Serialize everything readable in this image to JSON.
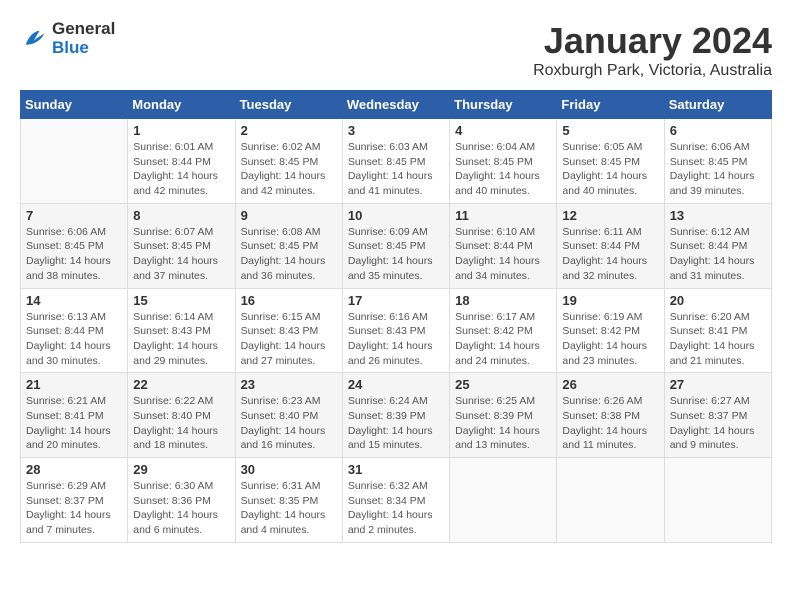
{
  "logo": {
    "line1": "General",
    "line2": "Blue"
  },
  "title": "January 2024",
  "subtitle": "Roxburgh Park, Victoria, Australia",
  "weekdays": [
    "Sunday",
    "Monday",
    "Tuesday",
    "Wednesday",
    "Thursday",
    "Friday",
    "Saturday"
  ],
  "weeks": [
    [
      {
        "day": "",
        "sunrise": "",
        "sunset": "",
        "daylight": ""
      },
      {
        "day": "1",
        "sunrise": "Sunrise: 6:01 AM",
        "sunset": "Sunset: 8:44 PM",
        "daylight": "Daylight: 14 hours and 42 minutes."
      },
      {
        "day": "2",
        "sunrise": "Sunrise: 6:02 AM",
        "sunset": "Sunset: 8:45 PM",
        "daylight": "Daylight: 14 hours and 42 minutes."
      },
      {
        "day": "3",
        "sunrise": "Sunrise: 6:03 AM",
        "sunset": "Sunset: 8:45 PM",
        "daylight": "Daylight: 14 hours and 41 minutes."
      },
      {
        "day": "4",
        "sunrise": "Sunrise: 6:04 AM",
        "sunset": "Sunset: 8:45 PM",
        "daylight": "Daylight: 14 hours and 40 minutes."
      },
      {
        "day": "5",
        "sunrise": "Sunrise: 6:05 AM",
        "sunset": "Sunset: 8:45 PM",
        "daylight": "Daylight: 14 hours and 40 minutes."
      },
      {
        "day": "6",
        "sunrise": "Sunrise: 6:06 AM",
        "sunset": "Sunset: 8:45 PM",
        "daylight": "Daylight: 14 hours and 39 minutes."
      }
    ],
    [
      {
        "day": "7",
        "sunrise": "Sunrise: 6:06 AM",
        "sunset": "Sunset: 8:45 PM",
        "daylight": "Daylight: 14 hours and 38 minutes."
      },
      {
        "day": "8",
        "sunrise": "Sunrise: 6:07 AM",
        "sunset": "Sunset: 8:45 PM",
        "daylight": "Daylight: 14 hours and 37 minutes."
      },
      {
        "day": "9",
        "sunrise": "Sunrise: 6:08 AM",
        "sunset": "Sunset: 8:45 PM",
        "daylight": "Daylight: 14 hours and 36 minutes."
      },
      {
        "day": "10",
        "sunrise": "Sunrise: 6:09 AM",
        "sunset": "Sunset: 8:45 PM",
        "daylight": "Daylight: 14 hours and 35 minutes."
      },
      {
        "day": "11",
        "sunrise": "Sunrise: 6:10 AM",
        "sunset": "Sunset: 8:44 PM",
        "daylight": "Daylight: 14 hours and 34 minutes."
      },
      {
        "day": "12",
        "sunrise": "Sunrise: 6:11 AM",
        "sunset": "Sunset: 8:44 PM",
        "daylight": "Daylight: 14 hours and 32 minutes."
      },
      {
        "day": "13",
        "sunrise": "Sunrise: 6:12 AM",
        "sunset": "Sunset: 8:44 PM",
        "daylight": "Daylight: 14 hours and 31 minutes."
      }
    ],
    [
      {
        "day": "14",
        "sunrise": "Sunrise: 6:13 AM",
        "sunset": "Sunset: 8:44 PM",
        "daylight": "Daylight: 14 hours and 30 minutes."
      },
      {
        "day": "15",
        "sunrise": "Sunrise: 6:14 AM",
        "sunset": "Sunset: 8:43 PM",
        "daylight": "Daylight: 14 hours and 29 minutes."
      },
      {
        "day": "16",
        "sunrise": "Sunrise: 6:15 AM",
        "sunset": "Sunset: 8:43 PM",
        "daylight": "Daylight: 14 hours and 27 minutes."
      },
      {
        "day": "17",
        "sunrise": "Sunrise: 6:16 AM",
        "sunset": "Sunset: 8:43 PM",
        "daylight": "Daylight: 14 hours and 26 minutes."
      },
      {
        "day": "18",
        "sunrise": "Sunrise: 6:17 AM",
        "sunset": "Sunset: 8:42 PM",
        "daylight": "Daylight: 14 hours and 24 minutes."
      },
      {
        "day": "19",
        "sunrise": "Sunrise: 6:19 AM",
        "sunset": "Sunset: 8:42 PM",
        "daylight": "Daylight: 14 hours and 23 minutes."
      },
      {
        "day": "20",
        "sunrise": "Sunrise: 6:20 AM",
        "sunset": "Sunset: 8:41 PM",
        "daylight": "Daylight: 14 hours and 21 minutes."
      }
    ],
    [
      {
        "day": "21",
        "sunrise": "Sunrise: 6:21 AM",
        "sunset": "Sunset: 8:41 PM",
        "daylight": "Daylight: 14 hours and 20 minutes."
      },
      {
        "day": "22",
        "sunrise": "Sunrise: 6:22 AM",
        "sunset": "Sunset: 8:40 PM",
        "daylight": "Daylight: 14 hours and 18 minutes."
      },
      {
        "day": "23",
        "sunrise": "Sunrise: 6:23 AM",
        "sunset": "Sunset: 8:40 PM",
        "daylight": "Daylight: 14 hours and 16 minutes."
      },
      {
        "day": "24",
        "sunrise": "Sunrise: 6:24 AM",
        "sunset": "Sunset: 8:39 PM",
        "daylight": "Daylight: 14 hours and 15 minutes."
      },
      {
        "day": "25",
        "sunrise": "Sunrise: 6:25 AM",
        "sunset": "Sunset: 8:39 PM",
        "daylight": "Daylight: 14 hours and 13 minutes."
      },
      {
        "day": "26",
        "sunrise": "Sunrise: 6:26 AM",
        "sunset": "Sunset: 8:38 PM",
        "daylight": "Daylight: 14 hours and 11 minutes."
      },
      {
        "day": "27",
        "sunrise": "Sunrise: 6:27 AM",
        "sunset": "Sunset: 8:37 PM",
        "daylight": "Daylight: 14 hours and 9 minutes."
      }
    ],
    [
      {
        "day": "28",
        "sunrise": "Sunrise: 6:29 AM",
        "sunset": "Sunset: 8:37 PM",
        "daylight": "Daylight: 14 hours and 7 minutes."
      },
      {
        "day": "29",
        "sunrise": "Sunrise: 6:30 AM",
        "sunset": "Sunset: 8:36 PM",
        "daylight": "Daylight: 14 hours and 6 minutes."
      },
      {
        "day": "30",
        "sunrise": "Sunrise: 6:31 AM",
        "sunset": "Sunset: 8:35 PM",
        "daylight": "Daylight: 14 hours and 4 minutes."
      },
      {
        "day": "31",
        "sunrise": "Sunrise: 6:32 AM",
        "sunset": "Sunset: 8:34 PM",
        "daylight": "Daylight: 14 hours and 2 minutes."
      },
      {
        "day": "",
        "sunrise": "",
        "sunset": "",
        "daylight": ""
      },
      {
        "day": "",
        "sunrise": "",
        "sunset": "",
        "daylight": ""
      },
      {
        "day": "",
        "sunrise": "",
        "sunset": "",
        "daylight": ""
      }
    ]
  ]
}
